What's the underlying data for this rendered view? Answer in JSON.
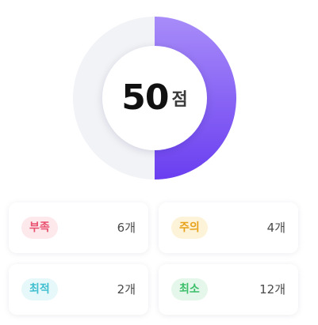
{
  "score": {
    "value": 50,
    "max": 100,
    "value_text": "50",
    "unit": "점",
    "colors": {
      "track": "#f2f3f7",
      "fill_top": "#a88cf9",
      "fill_bottom": "#6a3ef0"
    }
  },
  "categories": [
    {
      "label": "부족",
      "count": "6개",
      "text_color": "#e8506e",
      "bg_color": "#fde8ec"
    },
    {
      "label": "주의",
      "count": "4개",
      "text_color": "#e8a21a",
      "bg_color": "#fdf3d8"
    },
    {
      "label": "최적",
      "count": "2개",
      "text_color": "#3fbfcf",
      "bg_color": "#e6f8fa"
    },
    {
      "label": "최소",
      "count": "12개",
      "text_color": "#3cbf6a",
      "bg_color": "#e5f7ea"
    }
  ]
}
